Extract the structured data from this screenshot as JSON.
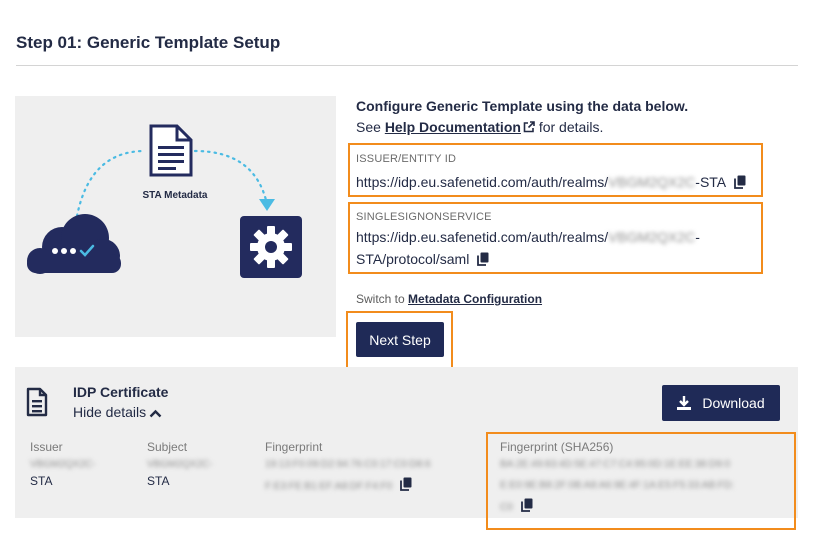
{
  "header": {
    "title": "Step 01: Generic Template Setup"
  },
  "illustration": {
    "metadata_label": "STA Metadata"
  },
  "configure": {
    "heading": "Configure Generic Template using the data below.",
    "see_prefix": "See",
    "help_link": "Help Documentation",
    "see_suffix": "for details."
  },
  "issuer": {
    "label": "ISSUER/ENTITY ID",
    "value_prefix": "https://idp.eu.safenetid.com/auth/realms/",
    "value_redacted": "VBGM2QX2C",
    "value_suffix": "-STA"
  },
  "sso": {
    "label": "SINGLESIGNONSERVICE",
    "value_prefix": "https://idp.eu.safenetid.com/auth/realms/",
    "value_redacted": "VBGM2QX2C",
    "value_suffix_1": "-",
    "value_suffix_2": "STA/protocol/saml"
  },
  "switch": {
    "prefix": "Switch to",
    "link": "Metadata Configuration"
  },
  "actions": {
    "next_step": "Next Step",
    "download": "Download"
  },
  "certificate": {
    "title": "IDP Certificate",
    "toggle": "Hide details",
    "columns": {
      "issuer": {
        "label": "Issuer",
        "redacted": "VBGM2QX2C-",
        "suffix": "STA"
      },
      "subject": {
        "label": "Subject",
        "redacted": "VBGM2QX2C-",
        "suffix": "STA"
      },
      "fingerprint": {
        "label": "Fingerprint",
        "line1": "19:13:F0:09:D2:94:76:C0:17:C0:D8:6",
        "line2": "F:E3:FE:B1:EF:A8:DF:F4:F0"
      },
      "fingerprint256": {
        "label": "Fingerprint (SHA256)",
        "line1": "BA:2E:49:83:4D:5E:47:C7:C4:95:0D:1E:EE:38:D9:0",
        "line2": "E:E0:9E:B8:2F:0B:A8:A6:9E:4F:1A:E5:F5:33:AB:FD:",
        "line3": "C0"
      }
    }
  },
  "colors": {
    "accent": "#f28c1c",
    "primary": "#1f2a57",
    "cloud": "#232b5e",
    "arrow": "#4bbbe3"
  }
}
